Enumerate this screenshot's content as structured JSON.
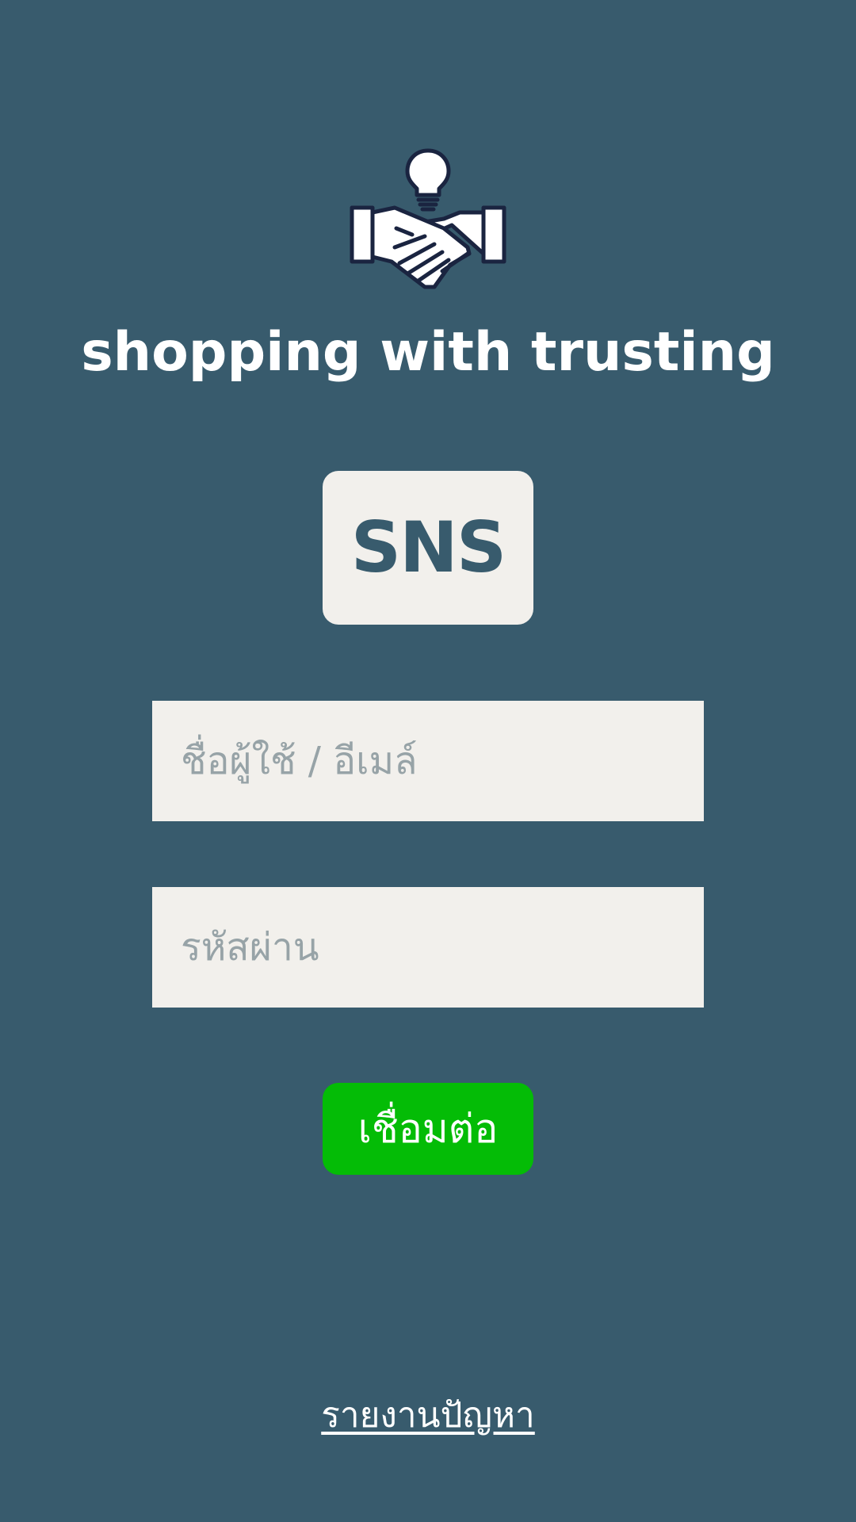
{
  "app": {
    "title": "shopping with trusting",
    "logo_icon": "handshake-lightbulb-icon"
  },
  "sns_button": {
    "label": "SNS"
  },
  "form": {
    "username_placeholder": "ชื่อผู้ใช้ / อีเมล์",
    "password_placeholder": "รหัสผ่าน",
    "connect_label": "เชื่อมต่อ"
  },
  "footer": {
    "report_label": "รายงานปัญหา"
  },
  "colors": {
    "background": "#385b6d",
    "field_background": "#f2f0ec",
    "placeholder": "#97a3a7",
    "accent_green": "#04bc06",
    "icon_outline": "#1a2440"
  }
}
